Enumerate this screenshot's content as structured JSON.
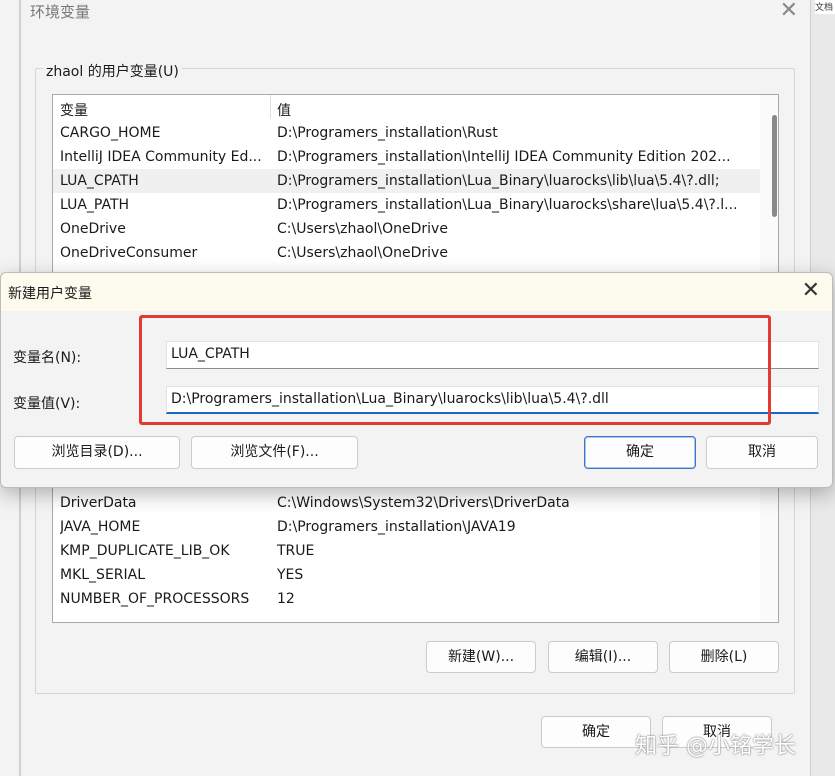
{
  "env_dialog": {
    "title": "环境变量",
    "close_glyph": "✕",
    "user_group_label": "zhaol 的用户变量(U)",
    "list_header": {
      "name": "变量",
      "value": "值"
    },
    "rows_top": [
      {
        "name": "CARGO_HOME",
        "value": "D:\\Programers_installation\\Rust"
      },
      {
        "name": "IntelliJ IDEA Community Ed...",
        "value": "D:\\Programers_installation\\IntelliJ IDEA Community Edition 202..."
      },
      {
        "name": "LUA_CPATH",
        "value": "D:\\Programers_installation\\Lua_Binary\\luarocks\\lib\\lua\\5.4\\?.dll;"
      },
      {
        "name": "LUA_PATH",
        "value": "D:\\Programers_installation\\Lua_Binary\\luarocks\\share\\lua\\5.4\\?.l..."
      },
      {
        "name": "OneDrive",
        "value": "C:\\Users\\zhaol\\OneDrive"
      },
      {
        "name": "OneDriveConsumer",
        "value": "C:\\Users\\zhaol\\OneDrive"
      }
    ],
    "rows_bottom": [
      {
        "name": "DriverData",
        "value": "C:\\Windows\\System32\\Drivers\\DriverData"
      },
      {
        "name": "JAVA_HOME",
        "value": "D:\\Programers_installation\\JAVA19"
      },
      {
        "name": "KMP_DUPLICATE_LIB_OK",
        "value": "TRUE"
      },
      {
        "name": "MKL_SERIAL",
        "value": "YES"
      },
      {
        "name": "NUMBER_OF_PROCESSORS",
        "value": "12"
      }
    ],
    "buttons": {
      "new": "新建(W)...",
      "edit": "编辑(I)...",
      "delete": "删除(L)"
    },
    "footer": {
      "ok": "确定",
      "cancel": "取消"
    }
  },
  "new_var_dialog": {
    "title": "新建用户变量",
    "close_glyph": "✕",
    "name_label": "变量名(N):",
    "value_label": "变量值(V):",
    "name_value": "LUA_CPATH",
    "value_value": "D:\\Programers_installation\\Lua_Binary\\luarocks\\lib\\lua\\5.4\\?.dll",
    "buttons": {
      "browse_dir": "浏览目录(D)...",
      "browse_file": "浏览文件(F)...",
      "ok": "确定",
      "cancel": "取消"
    }
  },
  "background_tab_text": "文档",
  "watermark": "知乎 @小铭学长"
}
